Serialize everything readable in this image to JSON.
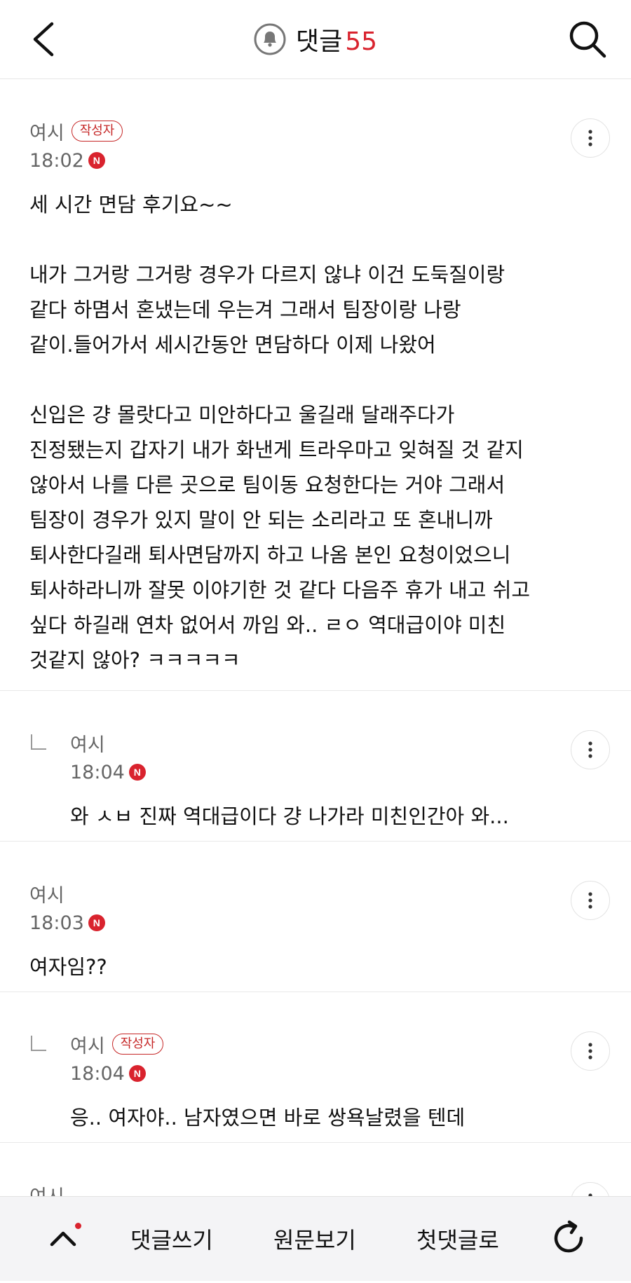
{
  "header": {
    "back_icon": "chevron-left-icon",
    "bell_icon": "bell-icon",
    "title": "댓글",
    "count": "55",
    "search_icon": "search-icon"
  },
  "comments": [
    {
      "nick": "여시",
      "author_badge": "작성자",
      "time": "18:02",
      "new_badge": "N",
      "body": "세 시간 면담 후기요~~\n\n내가 그거랑 그거랑 경우가 다르지 않냐 이건 도둑질이랑\n같다 하몀서 혼냈는데 우는겨 그래서 팀장이랑 나랑\n같이.들어가서 세시간동안 면담하다 이제 나왔어\n\n신입은 걍 몰랏다고 미안하다고 울길래 달래주다가\n진정됐는지 갑자기 내가 화낸게 트라우마고 잊혀질 것 같지\n않아서 나를 다른 곳으로 팀이동 요청한다는 거야 그래서\n팀장이 경우가 있지 말이 안 되는 소리라고 또 혼내니까\n퇴사한다길래 퇴사면담까지 하고 나옴 본인 요청이었으니\n퇴사하라니까 잘못 이야기한 것 같다 다음주 휴가 내고 쉬고\n싶다 하길래 연차 없어서 까임 와.. ㄹㅇ 역대급이야 미친\n것같지 않아? ㅋㅋㅋㅋㅋ"
    },
    {
      "nick": "여시",
      "time": "18:04",
      "new_badge": "N",
      "body": "와 ㅅㅂ 진짜 역대급이다 걍 나가라 미친인간아 와..."
    },
    {
      "nick": "여시",
      "time": "18:03",
      "new_badge": "N",
      "body": "여자임??"
    },
    {
      "nick": "여시",
      "author_badge": "작성자",
      "time": "18:04",
      "new_badge": "N",
      "body": "응.. 여자야.. 남자였으면 바로 쌍욕날렸을 텐데"
    },
    {
      "nick": "여시"
    }
  ],
  "more_icon": "more-vertical-icon",
  "bottom_bar": {
    "up_icon": "chevron-up-icon",
    "write_comment": "댓글쓰기",
    "view_original": "원문보기",
    "first_comment": "첫댓글로",
    "refresh_icon": "refresh-icon"
  }
}
